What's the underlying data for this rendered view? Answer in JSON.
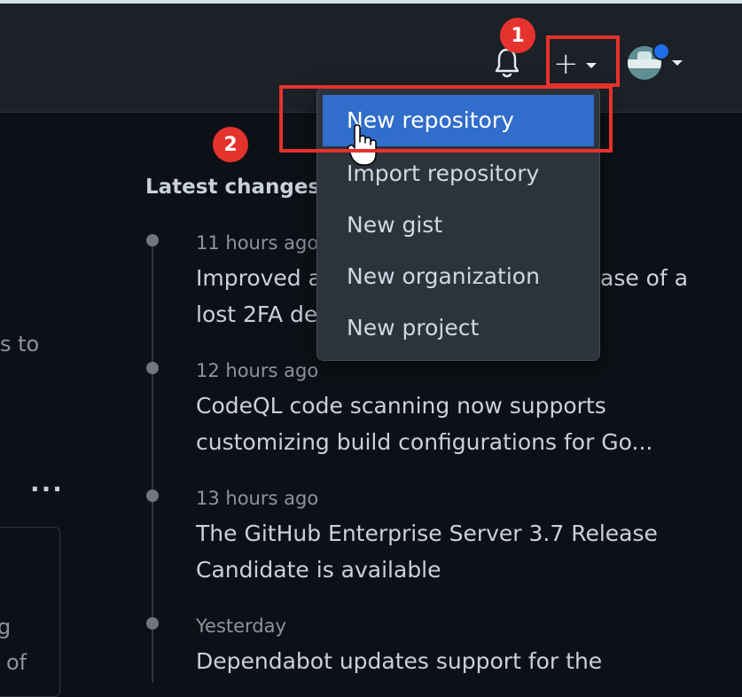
{
  "header": {
    "create_button_label": "+",
    "notifications_icon": "bell-icon",
    "avatar_icon": "avatar"
  },
  "annotations": {
    "step1": "1",
    "step2": "2"
  },
  "create_menu": {
    "items": [
      {
        "label": "New repository",
        "active": true
      },
      {
        "label": "Import repository",
        "active": false
      },
      {
        "label": "New gist",
        "active": false
      },
      {
        "label": "New organization",
        "active": false
      },
      {
        "label": "New project",
        "active": false
      }
    ]
  },
  "sidebar": {
    "partial_text_1": "s to",
    "more_label": "...",
    "partial_text_2": "g",
    "partial_text_3": "of"
  },
  "latest_changes": {
    "title": "Latest changes",
    "items": [
      {
        "time": "11 hours ago",
        "line1": "Improved a",
        "line1_tail": "ase of a",
        "line2": "lost 2FA de"
      },
      {
        "time": "12 hours ago",
        "line1": "CodeQL code scanning now supports",
        "line2": "customizing build configurations for Go..."
      },
      {
        "time": "13 hours ago",
        "line1": "The GitHub Enterprise Server 3.7 Release",
        "line2": "Candidate is available"
      },
      {
        "time": "Yesterday",
        "line1": "Dependabot updates support for the",
        "line2": ""
      }
    ]
  },
  "colors": {
    "background": "#0d1117",
    "header": "#1c2128",
    "menu_active": "#316dca",
    "annotation_red": "#e5322d"
  }
}
